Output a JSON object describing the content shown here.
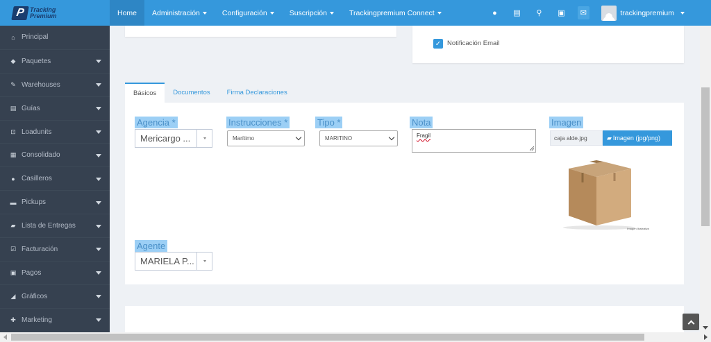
{
  "brand": {
    "line1": "Tracking",
    "line2": "Premium",
    "logo_letter": "P"
  },
  "nav": {
    "items": [
      {
        "label": "Home",
        "active": true,
        "caret": false
      },
      {
        "label": "Administración",
        "active": false,
        "caret": true
      },
      {
        "label": "Configuración",
        "active": false,
        "caret": true
      },
      {
        "label": "Suscripción",
        "active": false,
        "caret": true
      },
      {
        "label": "Trackingpremium Connect",
        "active": false,
        "caret": true
      }
    ],
    "icons": [
      "globe-icon",
      "list-icon",
      "search-icon",
      "money-icon",
      "envelope-icon"
    ],
    "user": "trackingpremium"
  },
  "sidebar": {
    "items": [
      {
        "label": "Principal",
        "icon": "home-icon",
        "glyph": "⌂",
        "caret": false
      },
      {
        "label": "Paquetes",
        "icon": "tag-icon",
        "glyph": "◆",
        "caret": true
      },
      {
        "label": "Warehouses",
        "icon": "edit-icon",
        "glyph": "✎",
        "caret": true
      },
      {
        "label": "Guías",
        "icon": "list-icon",
        "glyph": "▤",
        "caret": true
      },
      {
        "label": "Loadunits",
        "icon": "object-group-icon",
        "glyph": "⊡",
        "caret": true
      },
      {
        "label": "Consolidado",
        "icon": "table-icon",
        "glyph": "▦",
        "caret": true
      },
      {
        "label": "Casilleros",
        "icon": "map-marker-icon",
        "glyph": "●",
        "caret": true
      },
      {
        "label": "Pickups",
        "icon": "car-icon",
        "glyph": "▬",
        "caret": true
      },
      {
        "label": "Lista de Entregas",
        "icon": "truck-icon",
        "glyph": "▰",
        "caret": true
      },
      {
        "label": "Facturación",
        "icon": "check-square-icon",
        "glyph": "☑",
        "caret": true
      },
      {
        "label": "Pagos",
        "icon": "money-icon",
        "glyph": "▣",
        "caret": true
      },
      {
        "label": "Gráficos",
        "icon": "area-chart-icon",
        "glyph": "◢",
        "caret": true
      },
      {
        "label": "Marketing",
        "icon": "user-plus-icon",
        "glyph": "✚",
        "caret": true
      }
    ]
  },
  "notification": {
    "label": "Notificación Email",
    "checked": true
  },
  "tabs": [
    {
      "label": "Básicos",
      "active": true
    },
    {
      "label": "Documentos",
      "active": false
    },
    {
      "label": "Firma Declaraciones",
      "active": false
    }
  ],
  "form": {
    "agencia": {
      "label": "Agencia *",
      "value": "Mericargo ..."
    },
    "instrucciones": {
      "label": "Instrucciones *",
      "value": "Marítimo"
    },
    "tipo": {
      "label": "Tipo *",
      "value": "MARITINO"
    },
    "nota": {
      "label": "Nota",
      "value": "Fragil"
    },
    "imagen": {
      "label": "Imagen",
      "file_name": "caja alde.jpg",
      "button_label": "Imagen (jpg/png)",
      "caption": "Imagen Ilustrativa"
    },
    "agente": {
      "label": "Agente",
      "value": "MARIELA P..."
    }
  },
  "colors": {
    "accent": "#3598dc",
    "sidebar": "#364150",
    "label_highlight": "#9ccff5"
  }
}
